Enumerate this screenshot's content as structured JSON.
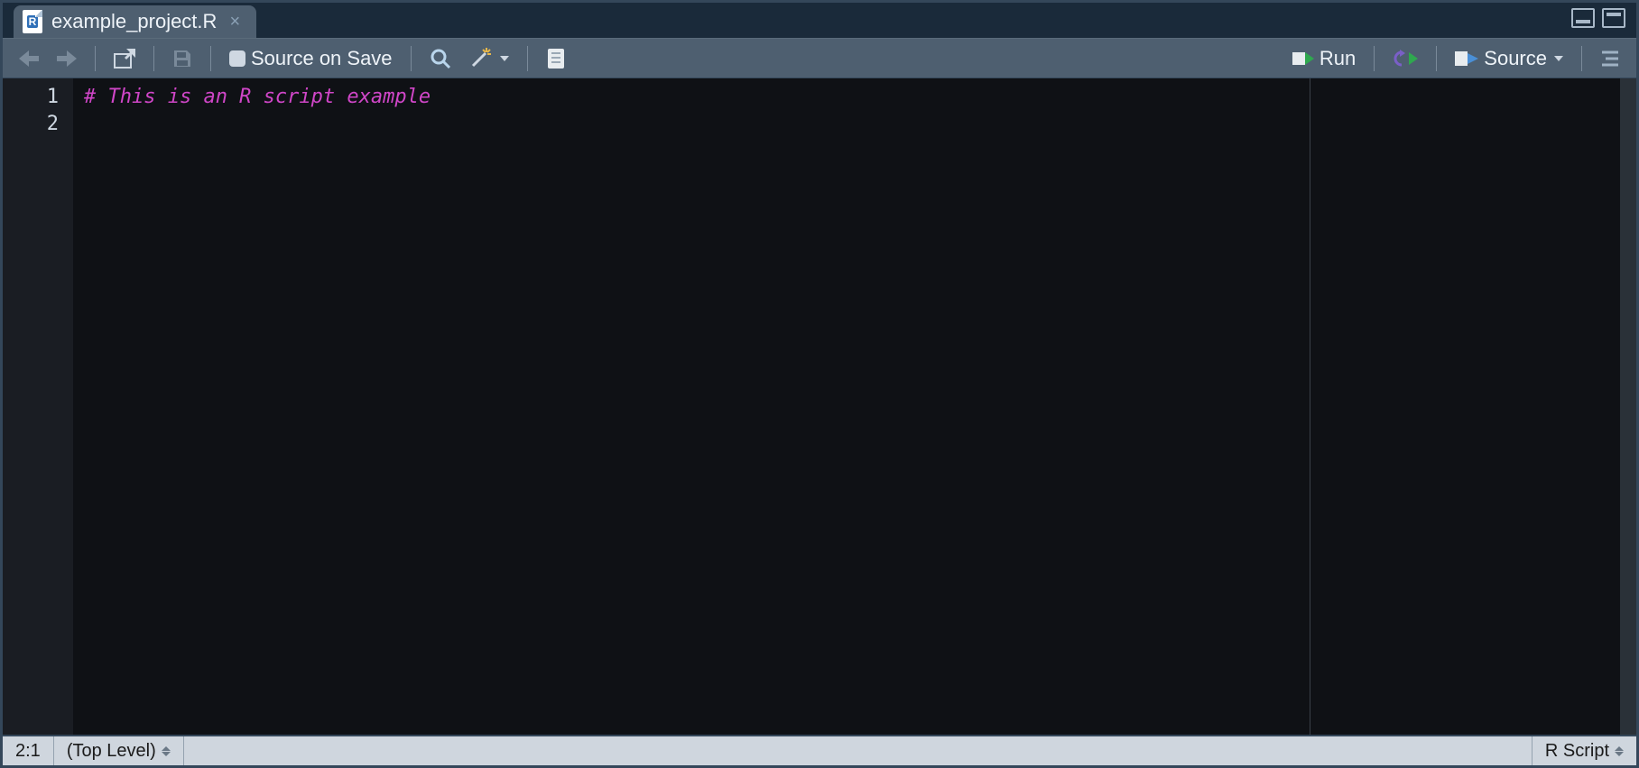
{
  "tab": {
    "filename": "example_project.R"
  },
  "toolbar": {
    "source_on_save_label": "Source on Save",
    "run_label": "Run",
    "source_label": "Source"
  },
  "editor": {
    "lines": [
      {
        "n": "1",
        "text": "# This is an R script example",
        "type": "comment"
      },
      {
        "n": "2",
        "text": "",
        "type": "plain"
      }
    ]
  },
  "status": {
    "cursor": "2:1",
    "scope": "(Top Level)",
    "filetype": "R Script"
  }
}
